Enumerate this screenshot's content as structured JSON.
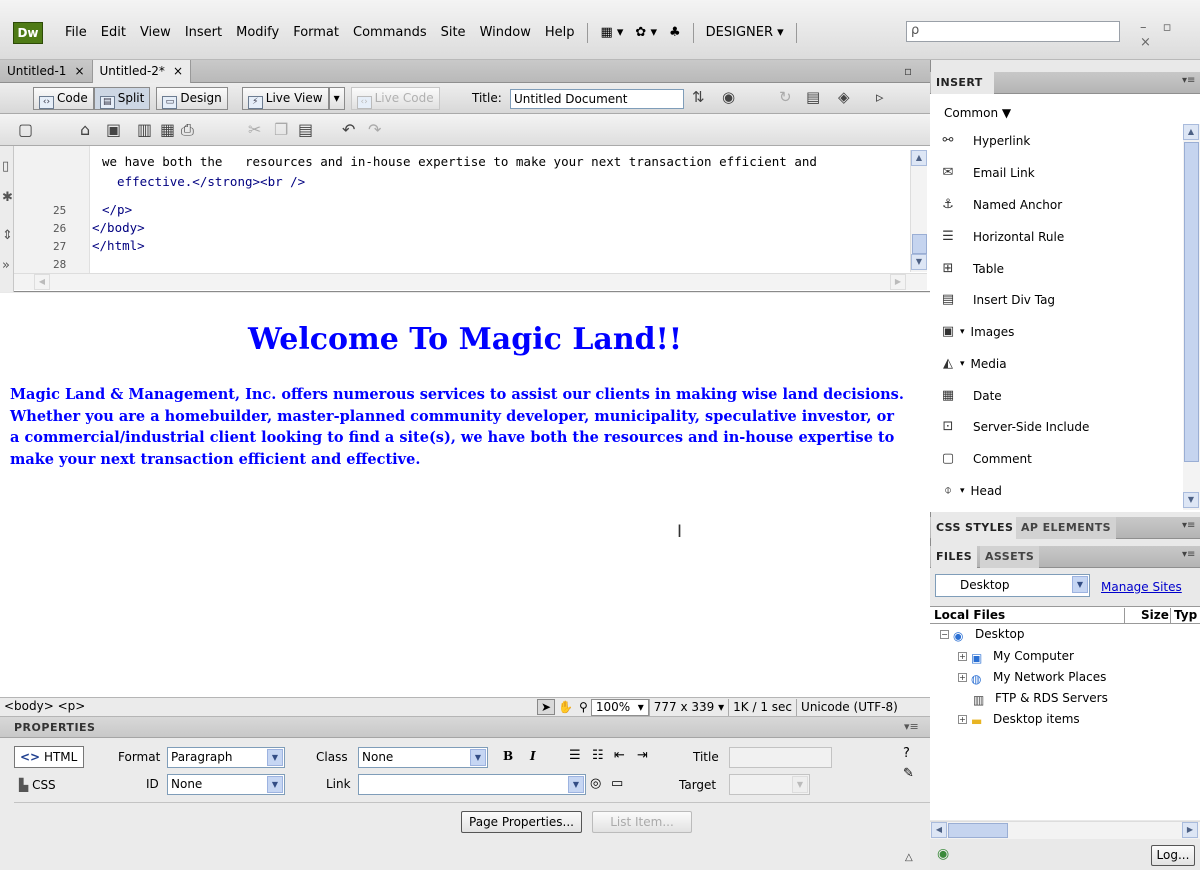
{
  "app": {
    "logo": "Dw",
    "menus": [
      "File",
      "Edit",
      "View",
      "Insert",
      "Modify",
      "Format",
      "Commands",
      "Site",
      "Window",
      "Help"
    ],
    "workspace": "DESIGNER ▾",
    "search_placeholder": "ρ",
    "window_controls": "– ▫ ×"
  },
  "tabs": [
    {
      "label": "Untitled-1",
      "close": "×"
    },
    {
      "label": "Untitled-2*",
      "close": "×"
    }
  ],
  "doc_toolbar": {
    "code": "Code",
    "split": "Split",
    "design": "Design",
    "live_view": "Live View",
    "live_code": "Live Code",
    "title_label": "Title:",
    "title_value": "Untitled Document"
  },
  "code": {
    "lines": [
      {
        "num": "",
        "text": "we have both the   resources and in-house expertise to make your next transaction efficient and"
      },
      {
        "num": "",
        "text": "  effective.</strong><br />"
      },
      {
        "num": "25",
        "text": "</p>"
      },
      {
        "num": "26",
        "text": "</body>"
      },
      {
        "num": "27",
        "text": "</html>"
      },
      {
        "num": "28",
        "text": ""
      }
    ]
  },
  "design": {
    "heading": "Welcome To Magic Land!!",
    "paragraph": "Magic Land & Management, Inc. offers numerous services to assist our clients in making wise land decisions. Whether you are a homebuilder, master-planned community developer, municipality, speculative investor, or a commercial/industrial client looking to find a site(s), we have both the resources and in-house expertise to make your next transaction efficient and effective."
  },
  "status": {
    "tag_selector": "<body> <p>",
    "zoom": "100%",
    "window_size": "777 x 339",
    "download": "1K / 1 sec",
    "encoding": "Unicode (UTF-8)"
  },
  "properties": {
    "title": "PROPERTIES",
    "html_btn": "HTML",
    "css_btn": "CSS",
    "format_label": "Format",
    "format_value": "Paragraph",
    "class_label": "Class",
    "class_value": "None",
    "id_label": "ID",
    "id_value": "None",
    "link_label": "Link",
    "link_value": "",
    "bold": "B",
    "italic": "I",
    "title_label": "Title",
    "target_label": "Target",
    "page_properties": "Page Properties...",
    "list_item": "List Item..."
  },
  "insert_panel": {
    "tab": "INSERT",
    "category": "Common",
    "items": [
      {
        "label": "Hyperlink",
        "icon": "hyperlink-icon"
      },
      {
        "label": "Email Link",
        "icon": "email-link-icon"
      },
      {
        "label": "Named Anchor",
        "icon": "anchor-icon"
      },
      {
        "label": "Horizontal Rule",
        "icon": "horizontal-rule-icon"
      },
      {
        "label": "Table",
        "icon": "table-icon"
      },
      {
        "label": "Insert Div Tag",
        "icon": "div-tag-icon"
      },
      {
        "label": "Images",
        "icon": "images-icon"
      },
      {
        "label": "Media",
        "icon": "media-icon"
      },
      {
        "label": "Date",
        "icon": "date-icon"
      },
      {
        "label": "Server-Side Include",
        "icon": "ssi-icon"
      },
      {
        "label": "Comment",
        "icon": "comment-icon"
      },
      {
        "label": "Head",
        "icon": "head-icon"
      }
    ]
  },
  "css_panel": {
    "tab1": "CSS STYLES",
    "tab2": "AP ELEMENTS"
  },
  "files_panel": {
    "tab1": "FILES",
    "tab2": "ASSETS",
    "site": "Desktop",
    "manage": "Manage Sites",
    "col_local": "Local Files",
    "col_size": "Size",
    "col_type": "Typ",
    "tree": [
      {
        "label": "Desktop",
        "level": 0,
        "expander": "⊟",
        "icon": "desktop-icon"
      },
      {
        "label": "My Computer",
        "level": 1,
        "expander": "+",
        "icon": "computer-icon"
      },
      {
        "label": "My Network Places",
        "level": 1,
        "expander": "+",
        "icon": "network-icon"
      },
      {
        "label": "FTP & RDS Servers",
        "level": 1,
        "expander": "",
        "icon": "server-icon"
      },
      {
        "label": "Desktop items",
        "level": 1,
        "expander": "+",
        "icon": "folder-icon"
      }
    ],
    "log": "Log..."
  }
}
